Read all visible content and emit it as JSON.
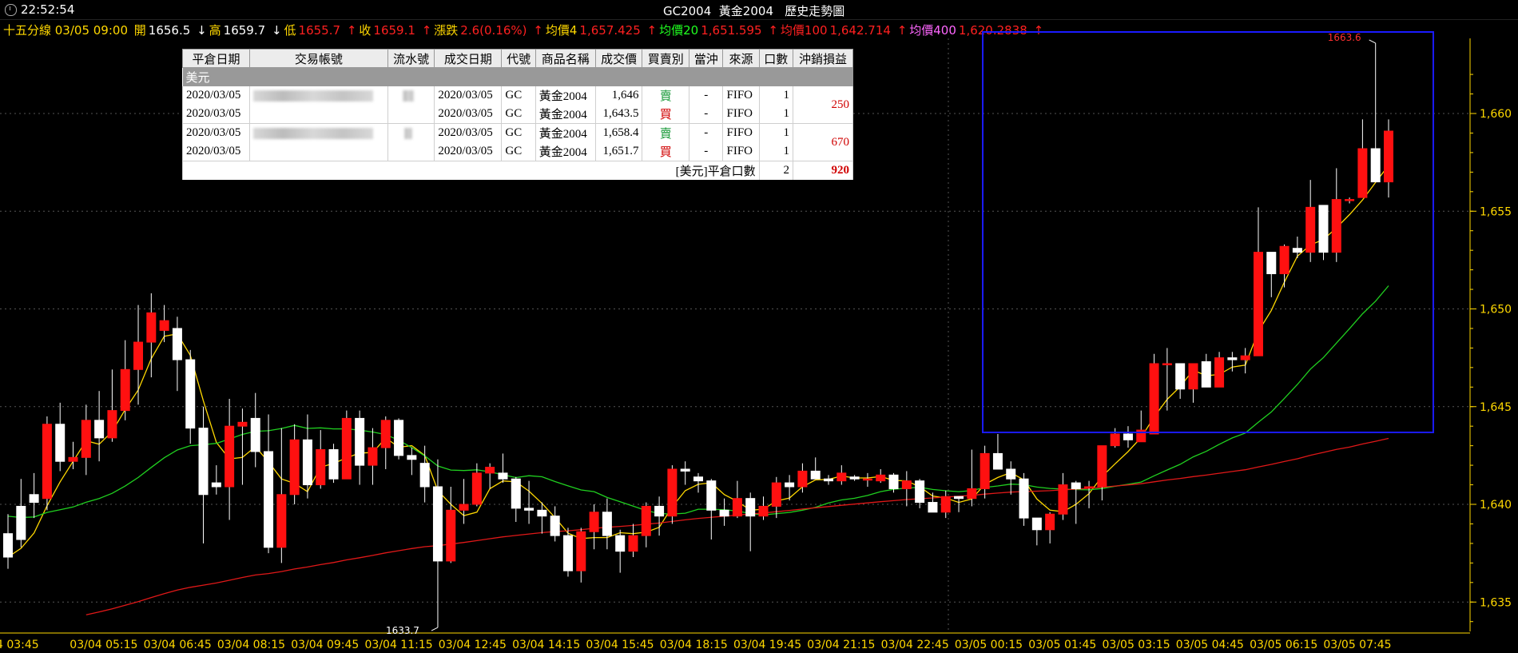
{
  "header": {
    "time": "22:52:54",
    "title": "GC2004  黃金2004   歷史走勢圖"
  },
  "info": {
    "period": "十五分線 03/05 09:00",
    "open_label": "開",
    "open": "1656.5",
    "high_label": "高",
    "high": "1659.7",
    "low_label": "低",
    "low": "1655.7",
    "close_label": "收",
    "close": "1659.1",
    "change_label": "漲跌",
    "change": "2.6(0.16%)",
    "ma4_label": "均價4",
    "ma4": "1,657.425",
    "ma20_label": "均價20",
    "ma20": "1,651.595",
    "ma100_label": "均價100",
    "ma100": "1,642.714",
    "ma400_label": "均價400",
    "ma400": "1,620.2838",
    "arrow_down": "↓",
    "arrow_up": "↑"
  },
  "table": {
    "headers": [
      "平倉日期",
      "交易帳號",
      "流水號",
      "成交日期",
      "代號",
      "商品名稱",
      "成交價",
      "買賣別",
      "當沖",
      "來源",
      "口數",
      "沖銷損益"
    ],
    "group": "美元",
    "rows": [
      {
        "close_date": "2020/03/05",
        "trade_date": "2020/03/05",
        "code": "GC",
        "name": "黃金2004",
        "price": "1,646",
        "side": "賣",
        "daytrade": "-",
        "source": "FIFO",
        "qty": "1"
      },
      {
        "close_date": "2020/03/05",
        "trade_date": "2020/03/05",
        "code": "GC",
        "name": "黃金2004",
        "price": "1,643.5",
        "side": "買",
        "daytrade": "-",
        "source": "FIFO",
        "qty": "1"
      },
      {
        "close_date": "2020/03/05",
        "trade_date": "2020/03/05",
        "code": "GC",
        "name": "黃金2004",
        "price": "1,658.4",
        "side": "賣",
        "daytrade": "-",
        "source": "FIFO",
        "qty": "1"
      },
      {
        "close_date": "2020/03/05",
        "trade_date": "2020/03/05",
        "code": "GC",
        "name": "黃金2004",
        "price": "1,651.7",
        "side": "買",
        "daytrade": "-",
        "source": "FIFO",
        "qty": "1"
      }
    ],
    "pnl": [
      "250",
      "670"
    ],
    "total_label": "[美元]平倉口數",
    "total_qty": "2",
    "total_pnl": "920"
  },
  "chart_data": {
    "type": "candlestick",
    "ylim": [
      1633,
      1651.8
    ],
    "y_ticks": [
      "1,635",
      "1,640",
      "1,645",
      "1,650",
      "1,655",
      "1,660"
    ],
    "x_labels": [
      "4 03:45",
      "03/04 05:15",
      "03/04 06:45",
      "03/04 08:15",
      "03/04 09:45",
      "03/04 11:15",
      "03/04 12:45",
      "03/04 14:15",
      "03/04 15:45",
      "03/04 18:15",
      "03/04 19:45",
      "03/04 21:15",
      "03/04 22:45",
      "03/05 00:15",
      "03/05 01:45",
      "03/05 03:15",
      "03/05 04:45",
      "03/05 06:15",
      "03/05 07:45"
    ],
    "annotations": [
      "1663.6",
      "1633.7"
    ],
    "candles": [
      [
        1638.5,
        1637.3,
        1636.7,
        1639.5
      ],
      [
        1639.9,
        1638.2,
        1637.8,
        1641.3
      ],
      [
        1640.5,
        1640.1,
        1639.3,
        1641.6
      ],
      [
        1640.3,
        1644.1,
        1639.7,
        1644.5
      ],
      [
        1644.1,
        1642.2,
        1641.7,
        1645.2
      ],
      [
        1642.2,
        1642.4,
        1641.8,
        1643.2
      ],
      [
        1642.4,
        1644.3,
        1641.5,
        1645.1
      ],
      [
        1644.3,
        1643.4,
        1642.2,
        1645.8
      ],
      [
        1643.4,
        1644.8,
        1643.2,
        1646.9
      ],
      [
        1644.8,
        1646.9,
        1644.3,
        1648.4
      ],
      [
        1646.9,
        1648.3,
        1645.1,
        1650.2
      ],
      [
        1648.3,
        1649.8,
        1646.5,
        1650.8
      ],
      [
        1648.9,
        1649.4,
        1648.3,
        1650.2
      ],
      [
        1649.0,
        1647.4,
        1645.8,
        1649.6
      ],
      [
        1647.4,
        1643.9,
        1643.1,
        1647.9
      ],
      [
        1643.9,
        1640.5,
        1638.0,
        1645.0
      ],
      [
        1641.1,
        1640.9,
        1640.5,
        1642.0
      ],
      [
        1640.9,
        1644.0,
        1639.2,
        1645.4
      ],
      [
        1644.0,
        1644.2,
        1641.0,
        1644.9
      ],
      [
        1644.4,
        1642.7,
        1641.9,
        1645.7
      ],
      [
        1642.7,
        1637.8,
        1637.5,
        1644.6
      ],
      [
        1637.8,
        1640.5,
        1637.0,
        1643.9
      ],
      [
        1640.5,
        1643.3,
        1640.0,
        1644.1
      ],
      [
        1643.3,
        1641.0,
        1640.3,
        1644.6
      ],
      [
        1641.0,
        1642.8,
        1640.8,
        1643.8
      ],
      [
        1642.8,
        1641.3,
        1641.1,
        1643.1
      ],
      [
        1641.3,
        1644.4,
        1641.4,
        1644.8
      ],
      [
        1644.4,
        1642.0,
        1641.0,
        1644.8
      ],
      [
        1642.0,
        1642.9,
        1641.0,
        1643.9
      ],
      [
        1642.9,
        1644.3,
        1641.8,
        1644.5
      ],
      [
        1644.3,
        1642.5,
        1642.3,
        1644.4
      ],
      [
        1642.5,
        1642.3,
        1641.5,
        1642.9
      ],
      [
        1642.1,
        1640.9,
        1640.1,
        1643.0
      ],
      [
        1640.9,
        1637.1,
        1633.7,
        1642.3
      ],
      [
        1637.1,
        1639.7,
        1637.0,
        1640.9
      ],
      [
        1639.7,
        1640.0,
        1639.0,
        1641.3
      ],
      [
        1640.0,
        1641.6,
        1639.9,
        1642.1
      ],
      [
        1641.6,
        1641.9,
        1640.8,
        1642.1
      ],
      [
        1641.6,
        1641.3,
        1641.1,
        1642.6
      ],
      [
        1641.3,
        1639.8,
        1639.1,
        1641.4
      ],
      [
        1639.8,
        1639.7,
        1639.0,
        1641.2
      ],
      [
        1639.7,
        1639.4,
        1638.5,
        1640.1
      ],
      [
        1639.4,
        1638.4,
        1638.1,
        1639.9
      ],
      [
        1638.4,
        1636.6,
        1636.3,
        1638.8
      ],
      [
        1636.6,
        1638.6,
        1636.0,
        1638.8
      ],
      [
        1638.6,
        1639.6,
        1637.7,
        1640.0
      ],
      [
        1639.6,
        1638.4,
        1637.7,
        1640.3
      ],
      [
        1638.4,
        1637.6,
        1636.5,
        1638.7
      ],
      [
        1637.6,
        1638.4,
        1637.3,
        1639.0
      ],
      [
        1638.4,
        1639.9,
        1637.8,
        1640.1
      ],
      [
        1639.9,
        1639.4,
        1638.4,
        1640.4
      ],
      [
        1639.4,
        1641.8,
        1639.0,
        1642.0
      ],
      [
        1641.8,
        1641.7,
        1641.0,
        1642.2
      ],
      [
        1641.4,
        1641.2,
        1640.6,
        1641.6
      ],
      [
        1641.2,
        1639.7,
        1638.2,
        1641.3
      ],
      [
        1639.7,
        1639.4,
        1638.9,
        1640.3
      ],
      [
        1639.4,
        1640.3,
        1639.3,
        1641.2
      ],
      [
        1640.3,
        1639.4,
        1637.6,
        1640.6
      ],
      [
        1639.4,
        1639.9,
        1639.2,
        1640.4
      ],
      [
        1639.9,
        1641.1,
        1639.3,
        1641.4
      ],
      [
        1641.1,
        1640.9,
        1640.2,
        1641.5
      ],
      [
        1640.9,
        1641.7,
        1640.6,
        1642.1
      ],
      [
        1641.7,
        1641.3,
        1641.3,
        1642.4
      ],
      [
        1641.3,
        1641.2,
        1641.0,
        1641.5
      ],
      [
        1641.2,
        1641.6,
        1641.0,
        1642.0
      ],
      [
        1641.4,
        1641.3,
        1641.2,
        1641.5
      ],
      [
        1641.3,
        1641.3,
        1640.9,
        1641.6
      ],
      [
        1641.2,
        1641.5,
        1641.1,
        1641.8
      ],
      [
        1641.5,
        1640.8,
        1640.6,
        1641.6
      ],
      [
        1640.8,
        1641.2,
        1639.9,
        1641.7
      ],
      [
        1641.2,
        1640.1,
        1639.8,
        1641.3
      ],
      [
        1640.1,
        1639.6,
        1639.6,
        1640.6
      ],
      [
        1639.6,
        1640.4,
        1639.3,
        1640.7
      ],
      [
        1640.4,
        1640.3,
        1639.6,
        1640.4
      ],
      [
        1640.3,
        1640.8,
        1639.9,
        1642.8
      ],
      [
        1640.8,
        1642.6,
        1640.3,
        1643.0
      ],
      [
        1642.6,
        1641.8,
        1641.9,
        1643.6
      ],
      [
        1641.8,
        1641.3,
        1640.5,
        1642.2
      ],
      [
        1641.3,
        1639.3,
        1638.9,
        1641.6
      ],
      [
        1639.3,
        1638.7,
        1637.9,
        1639.3
      ],
      [
        1638.7,
        1639.5,
        1638.0,
        1639.6
      ],
      [
        1639.5,
        1641.0,
        1639.2,
        1641.6
      ],
      [
        1641.1,
        1640.8,
        1639.0,
        1641.2
      ],
      [
        1640.9,
        1640.9,
        1639.8,
        1641.2
      ],
      [
        1640.9,
        1643.0,
        1640.2,
        1643.0
      ],
      [
        1643.0,
        1643.6,
        1642.9,
        1643.9
      ],
      [
        1643.6,
        1643.3,
        1642.9,
        1644.0
      ],
      [
        1643.2,
        1643.8,
        1643.6,
        1644.8
      ],
      [
        1643.6,
        1647.2,
        1645.3,
        1647.7
      ],
      [
        1647.2,
        1647.2,
        1644.8,
        1648.0
      ],
      [
        1647.2,
        1645.9,
        1645.4,
        1647.2
      ],
      [
        1645.9,
        1647.2,
        1645.2,
        1647.2
      ],
      [
        1647.3,
        1646.0,
        1646.0,
        1647.7
      ],
      [
        1646.0,
        1647.5,
        1646.6,
        1647.8
      ],
      [
        1647.5,
        1647.4,
        1646.8,
        1647.8
      ],
      [
        1647.4,
        1647.6,
        1646.7,
        1648.0
      ],
      [
        1647.6,
        1652.9,
        1648.0,
        1655.2
      ],
      [
        1652.9,
        1651.8,
        1650.6,
        1652.9
      ],
      [
        1651.8,
        1653.2,
        1651.1,
        1653.3
      ],
      [
        1653.1,
        1652.9,
        1652.6,
        1653.7
      ],
      [
        1652.9,
        1655.2,
        1652.4,
        1656.6
      ],
      [
        1655.3,
        1652.9,
        1652.5,
        1655.3
      ],
      [
        1652.9,
        1655.6,
        1652.4,
        1657.2
      ],
      [
        1655.6,
        1655.6,
        1655.4,
        1655.7
      ],
      [
        1655.7,
        1658.2,
        1655.7,
        1659.7
      ],
      [
        1658.2,
        1656.5,
        1656.5,
        1663.6
      ],
      [
        1656.5,
        1659.1,
        1655.7,
        1659.7
      ]
    ]
  }
}
